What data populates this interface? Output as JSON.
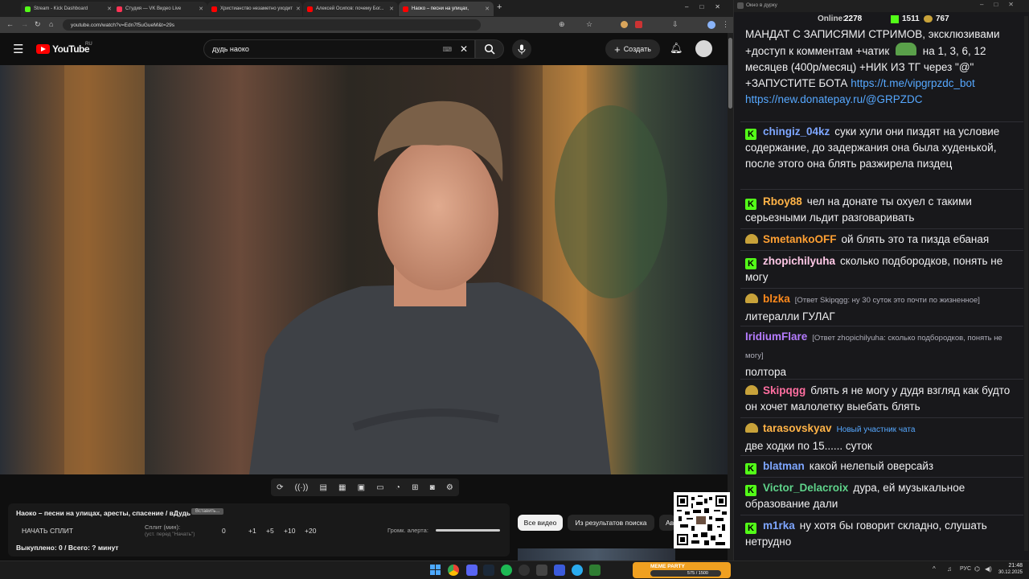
{
  "tabs": [
    {
      "title": "Stream - Kick Dashboard",
      "color": "#53fc18"
    },
    {
      "title": "Студия — VK Видео Live",
      "color": "#ff3355"
    },
    {
      "title": "Христианство незаметно уходит",
      "color": "#ff0000"
    },
    {
      "title": "Алексей Осипов: почему Бог...",
      "color": "#ff0000"
    },
    {
      "title": "Наоко – песни на улицах,",
      "color": "#ff0000"
    }
  ],
  "new_tab": "+",
  "address": "youtube.com/watch?v=Edn7f5uGueM&t=29s",
  "youtube": {
    "logo_text": "YouTube",
    "region": "RU",
    "search_value": "дудь наоко",
    "create_label": "Создать"
  },
  "panel": {
    "title": "Наоко – песни на улицах, аресты, спасение / вДудь",
    "small_btn": "Вставить...",
    "start_split": "НАЧАТЬ СПЛИТ",
    "split_label": "Сплит (мин):",
    "split_hint": "(уст. перед \"Начать\")",
    "split_value": "0",
    "inc1": "+1",
    "inc5": "+5",
    "inc10": "+10",
    "inc20": "+20",
    "volume_label": "Громк. алерта:",
    "bought": "Выкуплено: 0 / Всего: ? минут"
  },
  "chips": [
    "Все видео",
    "Из результатов поиска",
    "Ав"
  ],
  "chat": {
    "window_title": "Окно в дурку",
    "online_label": "Online:",
    "online": "2278",
    "kick_count": "1511",
    "other_count": "767",
    "top_text": "МАНДАТ С ЗАПИСЯМИ СТРИМОВ, эксклюзивами +доступ к комментам +чатик",
    "top_text2": "на 1, 3, 6, 12 месяцев (400р/месяц) +НИК ИЗ ТГ через \"@\" +ЗАПУСТИТЕ БОТА",
    "link1": "https://t.me/vipgrpzdc_bot",
    "link2": "https://new.donatepay.ru/@GRPZDC",
    "messages": [
      {
        "badge": "kick",
        "user": "chingiz_04kz",
        "color": "#7ea6ff",
        "text": "суки хули они пиздят на условие содержание, до задержания она была худенькой, после этого она блять разжирела пиздец"
      },
      {
        "badge": "kick",
        "user": "Rboy88",
        "color": "#ffb347",
        "text": "чел на донате ты охуел с такими серьезными льдит разговаривать"
      },
      {
        "badge": "pepe",
        "user": "SmetankoOFF",
        "color": "#ffa033",
        "text": "ой блять это та пизда ебаная"
      },
      {
        "badge": "kick",
        "user": "zhopichilyuha",
        "color": "#ffc8e6",
        "text": "сколько подбородков, понять не могу"
      },
      {
        "badge": "pepe",
        "user": "blzka",
        "color": "#ff8a1c",
        "reply": "[Ответ Skipqgg: ну 30 суток это почти по жизненное]",
        "text": "литералли ГУЛАГ"
      },
      {
        "badge": "none",
        "user": "IridiumFlare",
        "color": "#b57cff",
        "reply": "[Ответ zhopichilyuha: сколько подбородков, понять не могу]",
        "text": "полтора"
      },
      {
        "badge": "pepe",
        "user": "Skipqgg",
        "color": "#ff6fa0",
        "text": "блять я не могу у дудя взгляд как будто он хочет малолетку выебать блять"
      },
      {
        "badge": "pepe",
        "user": "tarasovskyav",
        "color": "#ffb347",
        "reply": "Новый участник чата",
        "text": "две ходки по 15...... суток"
      },
      {
        "badge": "kick",
        "user": "blatman",
        "color": "#7ea6ff",
        "text": "какой нелепый оверсайз"
      },
      {
        "badge": "kick",
        "user": "Victor_Delacroix",
        "color": "#5fd38a",
        "text": "дура, ей музыкальное образование дали"
      },
      {
        "badge": "kick",
        "user": "m1rka",
        "color": "#7ea6ff",
        "text": "ну хотя бы говорит складно, слушать нетрудно"
      }
    ]
  },
  "meme_widget": {
    "label": "MEME PARTY",
    "count": "575 / 1500"
  },
  "taskbar": {
    "lang": "РУС",
    "time": "21:48",
    "date": "30.12.2025"
  }
}
